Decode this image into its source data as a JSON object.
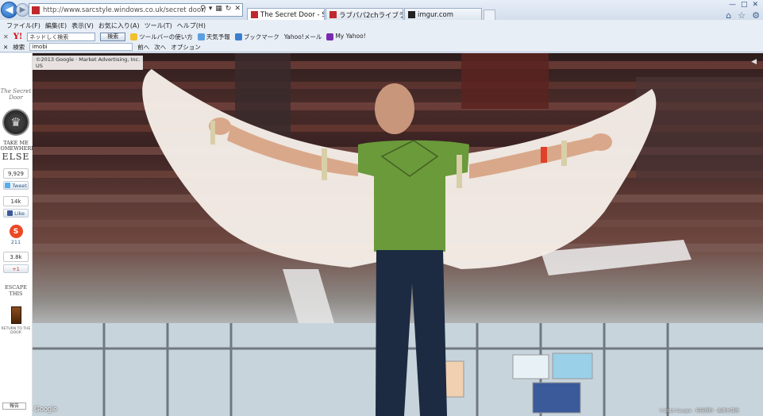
{
  "browser": {
    "url": "http://www.sarcstyle.windows.co.uk/secret door/",
    "tabs": [
      {
        "label": "The Secret Door - Step ...",
        "active": true
      },
      {
        "label": "ラブパパ2chライブラリー",
        "active": false
      },
      {
        "label": "imgur.com",
        "active": false
      }
    ],
    "menu": [
      "ファイル(F)",
      "編集(E)",
      "表示(V)",
      "お気に入り(A)",
      "ツール(T)",
      "ヘルプ(H)"
    ],
    "toolbar": {
      "search_value": "ネッドしく検索",
      "search_button": "検索",
      "items": [
        "ツールバーの使い方",
        "天気予報",
        "ブックマーク",
        "Yahoo!メール",
        "My Yahoo!"
      ]
    },
    "findbar": {
      "label": "検索",
      "value": "imobi",
      "prev": "前へ",
      "next": "次へ",
      "options": "オプション"
    }
  },
  "sidebar": {
    "logo_script": "The Secret Door",
    "take_me": "TAKE ME SOMEWHERE",
    "else_word": "ELSE",
    "tweet_count": "9,929",
    "tweet_label": "Tweet",
    "fb_count": "14k",
    "fb_label": "Like",
    "su_count": "211",
    "plus_count": "3.8k",
    "plus_label": "+1",
    "escape": "ESCAPE THIS",
    "return_door": "RETURN TO THE DOOR"
  },
  "pano": {
    "copyright": "©2013 Google · Market Advertising, Inc.",
    "copyright_line2": "US",
    "google": "Google",
    "report": "報告",
    "footer": "©2013 Google · 利用規約 · 画像を報告"
  }
}
